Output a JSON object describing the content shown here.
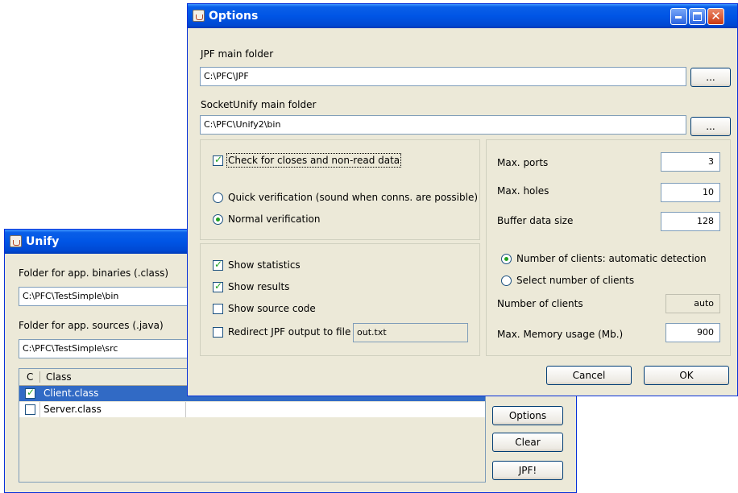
{
  "unify": {
    "title": "Unify",
    "binaries_label": "Folder for app. binaries (.class)",
    "binaries_value": "C:\\PFC\\TestSimple\\bin",
    "sources_label": "Folder for app. sources (.java)",
    "sources_value": "C:\\PFC\\TestSimple\\src",
    "table": {
      "columns": [
        "C",
        "Class"
      ],
      "rows": [
        {
          "checked": true,
          "name": "Client.class",
          "selected": true
        },
        {
          "checked": false,
          "name": "Server.class",
          "selected": false
        }
      ]
    },
    "buttons": {
      "options": "Options",
      "clear": "Clear",
      "jpf": "JPF!"
    }
  },
  "options": {
    "title": "Options",
    "jpf_folder_label": "JPF main folder",
    "jpf_folder_value": "C:\\PFC\\JPF",
    "socket_folder_label": "SocketUnify main folder",
    "socket_folder_value": "C:\\PFC\\Unify2\\bin",
    "browse_label": "...",
    "check_closes_label": "Check for closes and non-read data",
    "check_closes_checked": true,
    "quick_verification_label": "Quick verification (sound when conns. are possible)",
    "normal_verification_label": "Normal verification",
    "verification_mode": "normal",
    "show_statistics_label": "Show statistics",
    "show_statistics_checked": true,
    "show_results_label": "Show results",
    "show_results_checked": true,
    "show_source_label": "Show source code",
    "show_source_checked": false,
    "redirect_label": "Redirect JPF output to file",
    "redirect_checked": false,
    "redirect_file": "out.txt",
    "max_ports_label": "Max. ports",
    "max_ports_value": "3",
    "max_holes_label": "Max. holes",
    "max_holes_value": "10",
    "buffer_size_label": "Buffer data size",
    "buffer_size_value": "128",
    "clients_auto_label": "Number of clients: automatic detection",
    "clients_select_label": "Select number of clients",
    "clients_mode": "automatic",
    "num_clients_label": "Number of clients",
    "num_clients_value": "auto",
    "max_memory_label": "Max. Memory usage (Mb.)",
    "max_memory_value": "900",
    "cancel_label": "Cancel",
    "ok_label": "OK"
  },
  "icons": {
    "app": "java-cup-icon",
    "minimize": "minimize-icon",
    "maximize": "maximize-icon",
    "close": "close-icon",
    "check": "checkmark-icon"
  },
  "colors": {
    "titlebar": "#0055e5",
    "window_bg": "#ece9d8",
    "selection": "#316ac5",
    "check": "#21a121"
  }
}
